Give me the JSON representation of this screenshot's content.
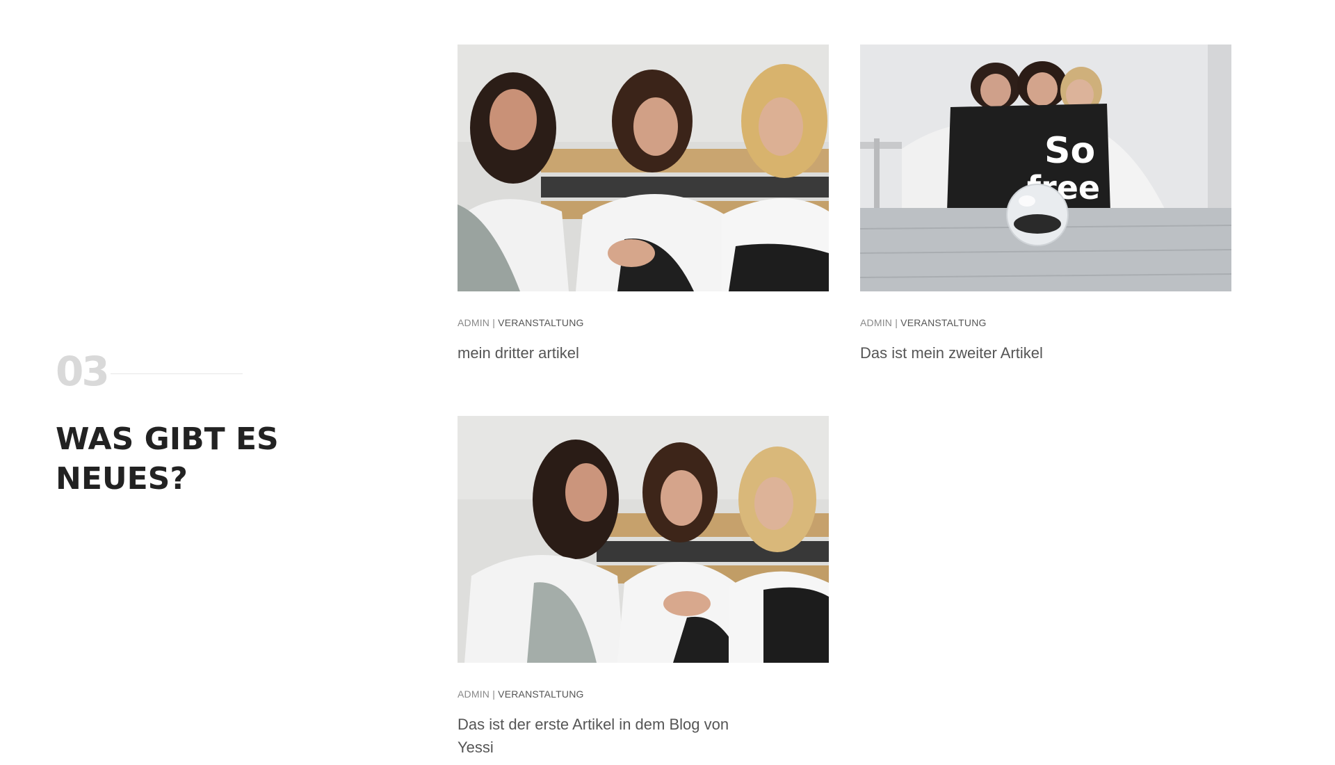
{
  "section": {
    "number": "03",
    "title": "WAS GIBT ES NEUES?"
  },
  "posts": [
    {
      "author": "ADMIN",
      "separator": "|",
      "category": "VERANSTALTUNG",
      "title": "mein dritter artikel",
      "image": "photo of three women sitting on a bench, two thinking"
    },
    {
      "author": "ADMIN",
      "separator": "|",
      "category": "VERANSTALTUNG",
      "title": "Das ist mein zweiter Artikel",
      "image": "photo of three women behind a black bag with a glass ball in front",
      "bag_text": "So free"
    },
    {
      "author": "ADMIN",
      "separator": "|",
      "category": "VERANSTALTUNG",
      "title": "Das ist der erste Artikel in dem Blog von Yessi",
      "image": "photo of three women laughing on a bench"
    }
  ]
}
